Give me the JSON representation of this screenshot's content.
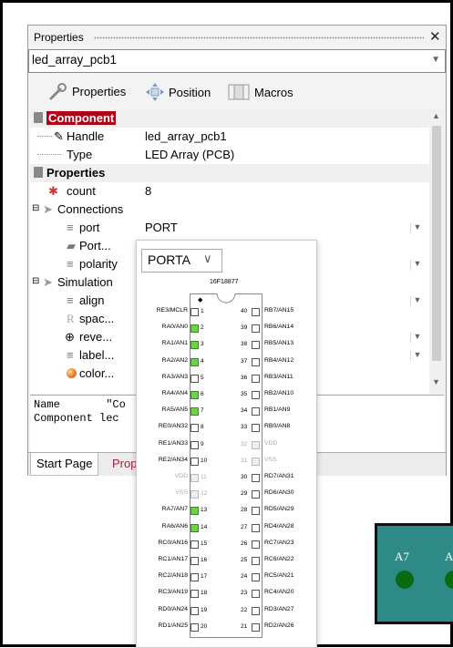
{
  "panel": {
    "title": "Properties",
    "component_name": "led_array_pcb1",
    "toolbar": {
      "properties": "Properties",
      "position": "Position",
      "macros": "Macros"
    }
  },
  "grid": {
    "rows": [
      {
        "kind": "cat-selected",
        "label": "Component",
        "value": ""
      },
      {
        "kind": "item",
        "label": "Handle",
        "value": "led_array_pcb1"
      },
      {
        "kind": "item",
        "label": "Type",
        "value": "LED Array (PCB)"
      },
      {
        "kind": "cat",
        "label": "Properties",
        "value": ""
      },
      {
        "kind": "item",
        "label": "count",
        "value": "8"
      },
      {
        "kind": "group",
        "label": "Connections",
        "value": ""
      },
      {
        "kind": "sub",
        "label": "port",
        "value": "PORT"
      },
      {
        "kind": "sub",
        "label": "Port...",
        "value": ""
      },
      {
        "kind": "sub",
        "label": "polarity",
        "value": ""
      },
      {
        "kind": "group",
        "label": "Simulation",
        "value": ""
      },
      {
        "kind": "sub",
        "label": "align",
        "value": ""
      },
      {
        "kind": "sub",
        "label": "spac...",
        "value": ""
      },
      {
        "kind": "sub",
        "label": "reve...",
        "value": ""
      },
      {
        "kind": "sub",
        "label": "label...",
        "value": ""
      },
      {
        "kind": "sub",
        "label": "color...",
        "value": ""
      }
    ]
  },
  "description": {
    "line1": "Name       \"Co",
    "line2": "Component lec"
  },
  "tabs": {
    "start": "Start Page",
    "prop": "Prop"
  },
  "popup": {
    "selected_port": "PORTA",
    "chip_name": "16F18877",
    "left_pins": [
      {
        "n": "1",
        "label": "RE3/MCLR",
        "state": "dot"
      },
      {
        "n": "2",
        "label": "RA0/AN0",
        "state": "on"
      },
      {
        "n": "3",
        "label": "RA1/AN1",
        "state": "on"
      },
      {
        "n": "4",
        "label": "RA2/AN2",
        "state": "on"
      },
      {
        "n": "5",
        "label": "RA3/AN3",
        "state": "off"
      },
      {
        "n": "6",
        "label": "RA4/AN4",
        "state": "on"
      },
      {
        "n": "7",
        "label": "RA5/AN5",
        "state": "on"
      },
      {
        "n": "8",
        "label": "RE0/AN32",
        "state": "off"
      },
      {
        "n": "9",
        "label": "RE1/AN33",
        "state": "off"
      },
      {
        "n": "10",
        "label": "RE2/AN34",
        "state": "off"
      },
      {
        "n": "11",
        "label": "VDD",
        "state": "gray"
      },
      {
        "n": "12",
        "label": "VSS",
        "state": "gray"
      },
      {
        "n": "13",
        "label": "RA7/AN7",
        "state": "on"
      },
      {
        "n": "14",
        "label": "RA6/AN6",
        "state": "on"
      },
      {
        "n": "15",
        "label": "RC0/AN16",
        "state": "off"
      },
      {
        "n": "16",
        "label": "RC1/AN17",
        "state": "off"
      },
      {
        "n": "17",
        "label": "RC2/AN18",
        "state": "off"
      },
      {
        "n": "18",
        "label": "RC3/AN19",
        "state": "off"
      },
      {
        "n": "19",
        "label": "RD0/AN24",
        "state": "off"
      },
      {
        "n": "20",
        "label": "RD1/AN25",
        "state": "off"
      }
    ],
    "right_pins": [
      {
        "n": "40",
        "label": "RB7/AN15",
        "state": "off"
      },
      {
        "n": "39",
        "label": "RB6/AN14",
        "state": "off"
      },
      {
        "n": "38",
        "label": "RB5/AN13",
        "state": "off"
      },
      {
        "n": "37",
        "label": "RB4/AN12",
        "state": "off"
      },
      {
        "n": "36",
        "label": "RB3/AN11",
        "state": "off"
      },
      {
        "n": "35",
        "label": "RB2/AN10",
        "state": "off"
      },
      {
        "n": "34",
        "label": "RB1/AN9",
        "state": "off"
      },
      {
        "n": "33",
        "label": "RB0/AN8",
        "state": "off"
      },
      {
        "n": "32",
        "label": "VDD",
        "state": "gray"
      },
      {
        "n": "31",
        "label": "VSS",
        "state": "gray"
      },
      {
        "n": "30",
        "label": "RD7/AN31",
        "state": "off"
      },
      {
        "n": "29",
        "label": "RD6/AN30",
        "state": "off"
      },
      {
        "n": "28",
        "label": "RD5/AN29",
        "state": "off"
      },
      {
        "n": "27",
        "label": "RD4/AN28",
        "state": "off"
      },
      {
        "n": "26",
        "label": "RC7/AN23",
        "state": "off"
      },
      {
        "n": "25",
        "label": "RC6/AN22",
        "state": "off"
      },
      {
        "n": "24",
        "label": "RC5/AN21",
        "state": "off"
      },
      {
        "n": "23",
        "label": "RC4/AN20",
        "state": "off"
      },
      {
        "n": "22",
        "label": "RD3/AN27",
        "state": "off"
      },
      {
        "n": "21",
        "label": "RD2/AN26",
        "state": "off"
      }
    ]
  },
  "pcb": {
    "labels": [
      "A7",
      "A"
    ]
  },
  "colors": {
    "selected_category": "#b00016",
    "pin_on": "#6fd04a",
    "pcb": "#2d8a86",
    "led": "#0a6a12"
  }
}
